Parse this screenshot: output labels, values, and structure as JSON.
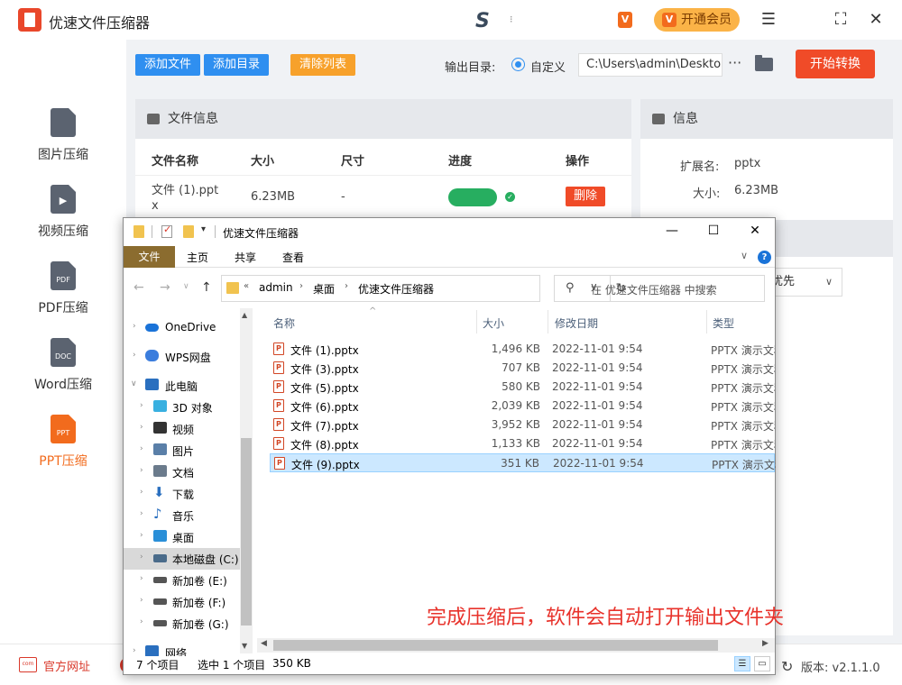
{
  "app": {
    "title": "优速文件压缩器",
    "vip_label": "开通会员",
    "vip_icon": "V"
  },
  "window_controls": {
    "menu": "☰",
    "maximize": "⛶",
    "close": "✕"
  },
  "sidebar": {
    "items": [
      {
        "label": "图片压缩",
        "icon_text": ""
      },
      {
        "label": "视频压缩",
        "icon_text": "▶"
      },
      {
        "label": "PDF压缩",
        "icon_text": "PDF"
      },
      {
        "label": "Word压缩",
        "icon_text": "DOC"
      },
      {
        "label": "PPT压缩",
        "icon_text": "PPT",
        "active": true
      }
    ]
  },
  "toolbar": {
    "add_file": "添加文件",
    "add_dir": "添加目录",
    "clear_list": "清除列表",
    "output_label": "输出目录:",
    "radio_custom": "自定义",
    "output_path": "C:\\Users\\admin\\Desktop",
    "more": "···",
    "start": "开始转换"
  },
  "file_panel": {
    "title": "文件信息",
    "headers": [
      "文件名称",
      "大小",
      "尺寸",
      "进度",
      "操作"
    ],
    "row": {
      "name_line1": "文件 (1).ppt",
      "name_line2": "x",
      "size": "6.23MB",
      "dimension": "-",
      "delete": "删除"
    }
  },
  "info_panel": {
    "title": "信息",
    "ext_label": "扩展名:",
    "ext_value": "pptx",
    "size_label": "大小:",
    "size_value": "6.23MB",
    "select_value": "优先"
  },
  "bottom": {
    "site": "官方网址",
    "version": "版本: v2.1.1.0"
  },
  "explorer": {
    "title": "优速文件压缩器",
    "ribbon": [
      "文件",
      "主页",
      "共享",
      "查看"
    ],
    "breadcrumb": [
      "admin",
      "桌面",
      "优速文件压缩器"
    ],
    "search_placeholder": "在 优速文件压缩器 中搜索",
    "nav": [
      {
        "label": "OneDrive",
        "color": "#1a73d8"
      },
      {
        "label": "WPS网盘",
        "color": "#3b7ddd"
      },
      {
        "label": "此电脑",
        "color": "#2a6fbf"
      },
      {
        "label": "3D 对象",
        "color": "#39b0e0"
      },
      {
        "label": "视频",
        "color": "#333333"
      },
      {
        "label": "图片",
        "color": "#5a7fa8"
      },
      {
        "label": "文档",
        "color": "#6b7b8c"
      },
      {
        "label": "下载",
        "color": "#2a6fbf"
      },
      {
        "label": "音乐",
        "color": "#2a6fbf"
      },
      {
        "label": "桌面",
        "color": "#2a8fd8"
      },
      {
        "label": "本地磁盘 (C:)",
        "color": "#4a6b8a"
      },
      {
        "label": "新加卷 (E:)",
        "color": "#555555"
      },
      {
        "label": "新加卷 (F:)",
        "color": "#555555"
      },
      {
        "label": "新加卷 (G:)",
        "color": "#555555"
      },
      {
        "label": "网络",
        "color": "#2a6fbf"
      }
    ],
    "columns": [
      "名称",
      "大小",
      "修改日期",
      "类型"
    ],
    "files": [
      {
        "name": "文件 (1).pptx",
        "size": "1,496 KB",
        "date": "2022-11-01 9:54",
        "type": "PPTX 演示文稿"
      },
      {
        "name": "文件 (3).pptx",
        "size": "707 KB",
        "date": "2022-11-01 9:54",
        "type": "PPTX 演示文稿"
      },
      {
        "name": "文件 (5).pptx",
        "size": "580 KB",
        "date": "2022-11-01 9:54",
        "type": "PPTX 演示文稿"
      },
      {
        "name": "文件 (6).pptx",
        "size": "2,039 KB",
        "date": "2022-11-01 9:54",
        "type": "PPTX 演示文稿"
      },
      {
        "name": "文件 (7).pptx",
        "size": "3,952 KB",
        "date": "2022-11-01 9:54",
        "type": "PPTX 演示文稿"
      },
      {
        "name": "文件 (8).pptx",
        "size": "1,133 KB",
        "date": "2022-11-01 9:54",
        "type": "PPTX 演示文稿"
      },
      {
        "name": "文件 (9).pptx",
        "size": "351 KB",
        "date": "2022-11-01 9:54",
        "type": "PPTX 演示文稿",
        "selected": true
      }
    ],
    "annotation": "完成压缩后，软件会自动打开输出文件夹",
    "status": {
      "count": "7 个项目",
      "selected": "选中 1 个项目",
      "size": "350 KB"
    }
  },
  "colors": {
    "accent": "#f26b1d",
    "blue": "#2f8ff0",
    "red": "#f04b28",
    "green": "#27ae60"
  }
}
